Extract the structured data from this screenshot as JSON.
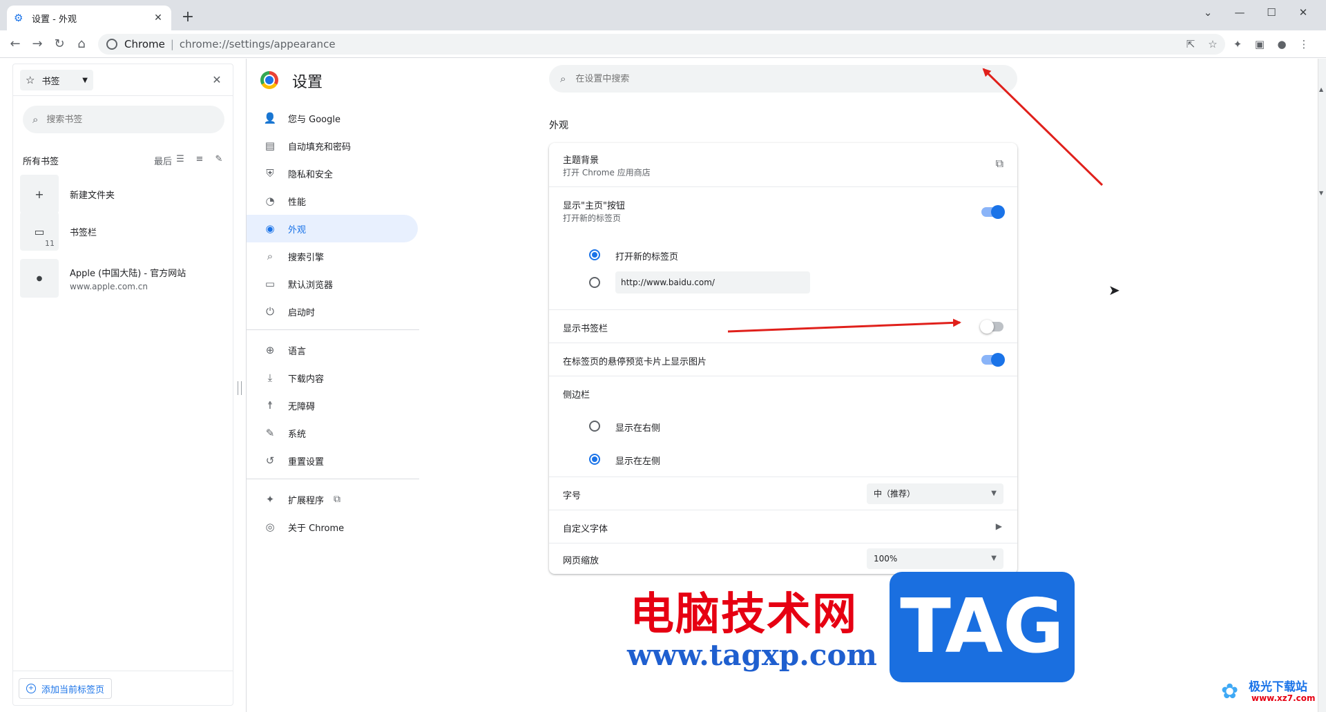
{
  "tab": {
    "title": "设置 - 外观",
    "close": "✕"
  },
  "window": {
    "newtab": "+",
    "minimize_menu": "⌄",
    "minimize": "—",
    "maximize": "☐",
    "close": "✕"
  },
  "toolbar": {
    "back": "←",
    "forward": "→",
    "reload": "↻",
    "home": "⌂",
    "site": "Chrome",
    "separator": "|",
    "url": "chrome://settings/appearance",
    "share": "⇱",
    "star": "☆",
    "extensions": "✦",
    "sidepanel": "▣",
    "profile": "●",
    "menu": "⋮"
  },
  "bookmarks_panel": {
    "dropdown_label": "书签",
    "search_placeholder": "搜索书签",
    "all_label": "所有书签",
    "sort_label": "最后",
    "items": [
      {
        "title": "新建文件夹",
        "url": "",
        "icon": "plus-icon",
        "glyph": "+"
      },
      {
        "title": "书签栏",
        "url": "",
        "icon": "folder-icon",
        "glyph": "▭",
        "count": "11"
      },
      {
        "title": "Apple (中国大陆) - 官方网站",
        "url": "www.apple.com.cn",
        "icon": "apple-icon",
        "glyph": "●"
      }
    ],
    "add_current": "添加当前标签页"
  },
  "settings": {
    "title": "设置",
    "search_placeholder": "在设置中搜索",
    "nav": [
      {
        "label": "您与 Google",
        "icon": "person-icon",
        "glyph": "👤"
      },
      {
        "label": "自动填充和密码",
        "icon": "clipboard-icon",
        "glyph": "▤"
      },
      {
        "label": "隐私和安全",
        "icon": "shield-icon",
        "glyph": "⛨"
      },
      {
        "label": "性能",
        "icon": "speedometer-icon",
        "glyph": "◔"
      },
      {
        "label": "外观",
        "icon": "palette-icon",
        "glyph": "◉"
      },
      {
        "label": "搜索引擎",
        "icon": "search-icon",
        "glyph": "⌕"
      },
      {
        "label": "默认浏览器",
        "icon": "browser-icon",
        "glyph": "▭"
      },
      {
        "label": "启动时",
        "icon": "power-icon",
        "glyph": "⏻"
      },
      {
        "label": "语言",
        "icon": "globe-icon",
        "glyph": "⊕"
      },
      {
        "label": "下载内容",
        "icon": "download-icon",
        "glyph": "⤓"
      },
      {
        "label": "无障碍",
        "icon": "accessibility-icon",
        "glyph": "☨"
      },
      {
        "label": "系统",
        "icon": "wrench-icon",
        "glyph": "✎"
      },
      {
        "label": "重置设置",
        "icon": "history-icon",
        "glyph": "↺"
      },
      {
        "label": "扩展程序",
        "icon": "puzzle-icon",
        "glyph": "✦"
      },
      {
        "label": "关于 Chrome",
        "icon": "chrome-icon",
        "glyph": "◎"
      }
    ],
    "section_title": "外观",
    "theme": {
      "label": "主题背景",
      "sub": "打开 Chrome 应用商店"
    },
    "home_button": {
      "label": "显示\"主页\"按钮",
      "sub": "打开新的标签页",
      "enabled": true
    },
    "home_options": {
      "new_tab": "打开新的标签页",
      "custom_url": "http://www.baidu.com/",
      "selected": "new_tab"
    },
    "bookmarks_bar": {
      "label": "显示书签栏",
      "enabled": false
    },
    "hover_preview": {
      "label": "在标签页的悬停预览卡片上显示图片",
      "enabled": true
    },
    "side_panel": {
      "label": "侧边栏",
      "right": "显示在右侧",
      "left": "显示在左侧",
      "selected": "left"
    },
    "font_size": {
      "label": "字号",
      "value": "中（推荐）"
    },
    "custom_fonts": {
      "label": "自定义字体"
    },
    "page_zoom": {
      "label": "网页缩放",
      "value": "100%"
    }
  },
  "watermark": {
    "title": "电脑技术网",
    "url": "www.tagxp.com",
    "badge": "TAG",
    "corner_title": "极光下载站",
    "corner_url": "www.xz7.com"
  },
  "colors": {
    "accent": "#1a73e8",
    "arrow": "#e0201b",
    "watermark_red": "#e60012",
    "watermark_blue": "#1a6fe0"
  }
}
